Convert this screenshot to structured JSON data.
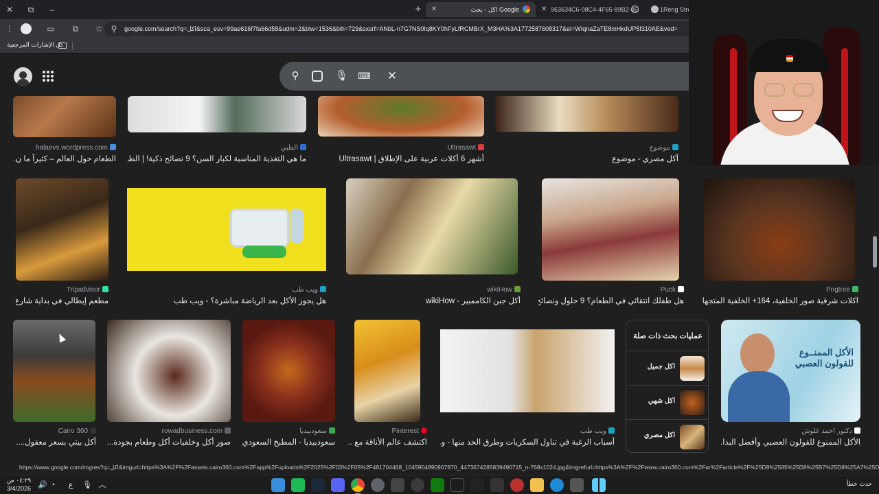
{
  "window": {
    "minimize": "–",
    "restore": "⧉",
    "close": "✕"
  },
  "tabs": [
    {
      "title": "اكل - بحث Google",
      "active": true
    },
    {
      "title": "963634C6-08C4-4F65-89B2-4E",
      "active": false
    },
    {
      "title": "1Reng Strea",
      "active": false
    }
  ],
  "new_tab": "+",
  "address_bar": {
    "url": "google.com/search?q=اكل&sca_esv=99ae616f7fa66d58&udm=2&biw=1536&bih=729&sxsrf=ANbL-n7G7NS0Iq8KY0hFyLfRCMBrX_M3HA%3A1772587608317&ei=WIqnaZaTE8mHkdUP5f310AE&ved="
  },
  "bookmarks": {
    "folder_label": "كل الإشارات المرجعية"
  },
  "colors": {
    "background": "#1f1f1f",
    "searchbox": "#4d5156",
    "text": "#e8eaed",
    "muted": "#9aa0a6"
  },
  "results": {
    "row1": [
      {
        "source": "halaevs.wordpress.com",
        "caption": "الطعام حول العالم – كثيراً ما ن..."
      },
      {
        "source": "الطبي",
        "caption": "ما هي التغذية المناسبة لكبار السن؟ 9 نصائح ذكية! | الطبي"
      },
      {
        "source": "Ultrasawt",
        "caption": "أشهر 6 أكلات عربية على الإطلاق | Ultrasawt"
      },
      {
        "source": "موضوع",
        "caption": "أكل مصري - موضوع"
      }
    ],
    "row2": [
      {
        "source": "Tripadvisor",
        "caption": "مطعم إيطالي في بداية شارع ..."
      },
      {
        "source": "ويب طب",
        "caption": "هل يجوز الأكل بعد الرياضة مباشرة؟ - ويب طب"
      },
      {
        "source": "wikiHow",
        "caption": "أكل جبن الكاممبير - wikiHow"
      },
      {
        "source": "Puck",
        "caption": "هل طفلك انتقائي في الطعام؟ 9 حلول ونصائح لـ..."
      },
      {
        "source": "Pngtree",
        "caption": "اكلات شرقية صور الخلفية، 164+ الخلفية المتجها..."
      }
    ],
    "row3": [
      {
        "source": "Cairo 360",
        "caption": "أكل بيتي بسعر معقول...."
      },
      {
        "source": "rowadbusiness.com",
        "caption": "صور أكل وخلفيات أكل وطعام بجودة..."
      },
      {
        "source": "سعودبيديا",
        "caption": "سعودبيديا - المطبخ السعودي"
      },
      {
        "source": "Pinterest",
        "caption": "اكتشف عالم الأناقة مع ..."
      },
      {
        "source": "ويب طب",
        "caption": "أسباب الرغبة في تناول السكريات وطرق الحد منها - و..."
      },
      {
        "source": "دكتور احمد غلوش",
        "caption": "الأكل الممنوع للقولون العصبي وأفضل البدا..."
      }
    ],
    "ad_text": "الأكل الممنــوع للقولون العصبي"
  },
  "related_searches": {
    "title": "عمليات بحث ذات صلة",
    "items": [
      {
        "label": "اكل جميل"
      },
      {
        "label": "اكل شهي"
      },
      {
        "label": "اكل مصري"
      }
    ]
  },
  "status_url": "https://www.google.com/imgres?q=اكل&imgurl=https%3A%2F%2Fassets.cairo360.com%2Fapp%2Fuploads%2F2025%2F03%2F05%2F481704468_1045904890907870_4473674285839490715_n-768x1024.jpg&imgrefurl=https%3A%2F%2Fwww.cairo360.com%2Far%2Farticle%2F%25D9%2585%25D8%25B7%25D8%25A7%25D8%25B9%25D9%2585%2F...",
  "taskbar": {
    "time": "٠٤:٢٩ ص",
    "date": "3/4/2026",
    "lang": "ع",
    "weather": "حدث خطأ"
  }
}
